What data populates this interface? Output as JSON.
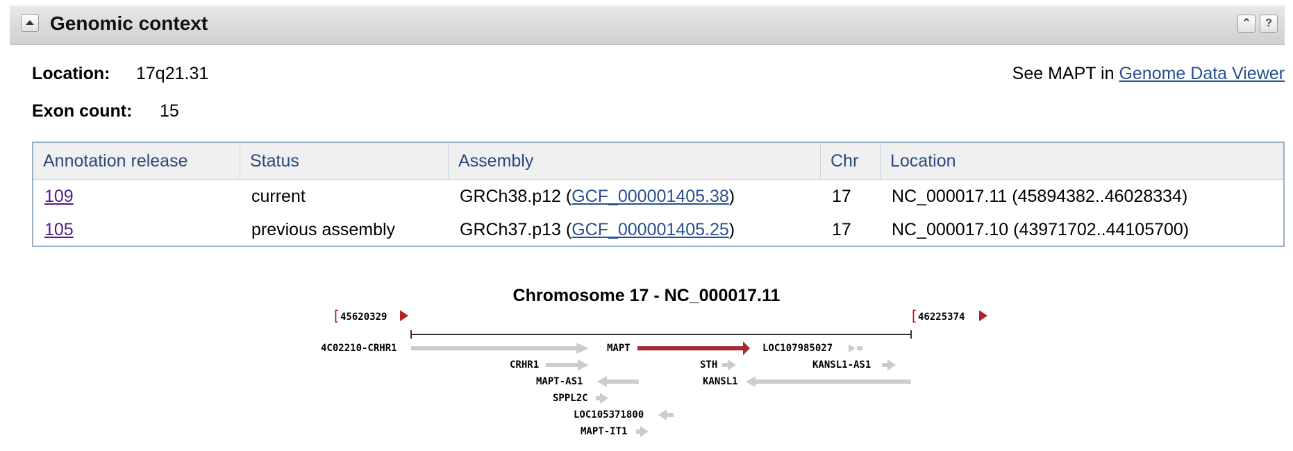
{
  "section": {
    "title": "Genomic context",
    "collapse_icon": "collapse-up-icon",
    "header_buttons": [
      "collapse-all-icon",
      "help-icon"
    ],
    "help_label": "?"
  },
  "summary": {
    "location_label": "Location:",
    "location_value": "17q21.31",
    "exon_label": "Exon count:",
    "exon_value": "15",
    "see_prefix": "See MAPT in",
    "see_link": "Genome Data Viewer"
  },
  "table": {
    "headers": [
      "Annotation release",
      "Status",
      "Assembly",
      "Chr",
      "Location"
    ],
    "rows": [
      {
        "release": "109",
        "status": "current",
        "assembly_prefix": "GRCh38.p12 (",
        "assembly_link": "GCF_000001405.38",
        "assembly_suffix": ")",
        "chr": "17",
        "location": "NC_000017.11 (45894382..46028334)"
      },
      {
        "release": "105",
        "status": "previous assembly",
        "assembly_prefix": "GRCh37.p13 (",
        "assembly_link": "GCF_000001405.25",
        "assembly_suffix": ")",
        "chr": "17",
        "location": "NC_000017.10 (43971702..44105700)"
      }
    ]
  },
  "context_map": {
    "title": "Chromosome 17 - NC_000017.11",
    "left_bound": "45620329",
    "right_bound": "46225374",
    "genes": [
      {
        "name": "LOC102210-CRHR1",
        "label_text": "4C02210-CRHR1",
        "direction": "right",
        "highlight": false
      },
      {
        "name": "MAPT",
        "label_text": "MAPT",
        "direction": "right",
        "highlight": true
      },
      {
        "name": "LOC107985027",
        "label_text": "LOC107985027",
        "direction": "left",
        "highlight": false
      },
      {
        "name": "CRHR1",
        "label_text": "CRHR1",
        "direction": "right",
        "highlight": false
      },
      {
        "name": "STH",
        "label_text": "STH",
        "direction": "right",
        "highlight": false
      },
      {
        "name": "KANSL1-AS1",
        "label_text": "KANSL1-AS1",
        "direction": "right",
        "highlight": false
      },
      {
        "name": "MAPT-AS1",
        "label_text": "MAPT-AS1",
        "direction": "left",
        "highlight": false
      },
      {
        "name": "KANSL1",
        "label_text": "KANSL1",
        "direction": "left",
        "highlight": false
      },
      {
        "name": "SPPL2C",
        "label_text": "SPPL2C",
        "direction": "right",
        "highlight": false
      },
      {
        "name": "LOC105371800",
        "label_text": "LOC105371800",
        "direction": "left",
        "highlight": false
      },
      {
        "name": "MAPT-IT1",
        "label_text": "MAPT-IT1",
        "direction": "right",
        "highlight": false
      }
    ],
    "colors": {
      "highlight": "#a52a2a",
      "gene": "#cccccc",
      "bound_marker": "#b22222"
    }
  }
}
